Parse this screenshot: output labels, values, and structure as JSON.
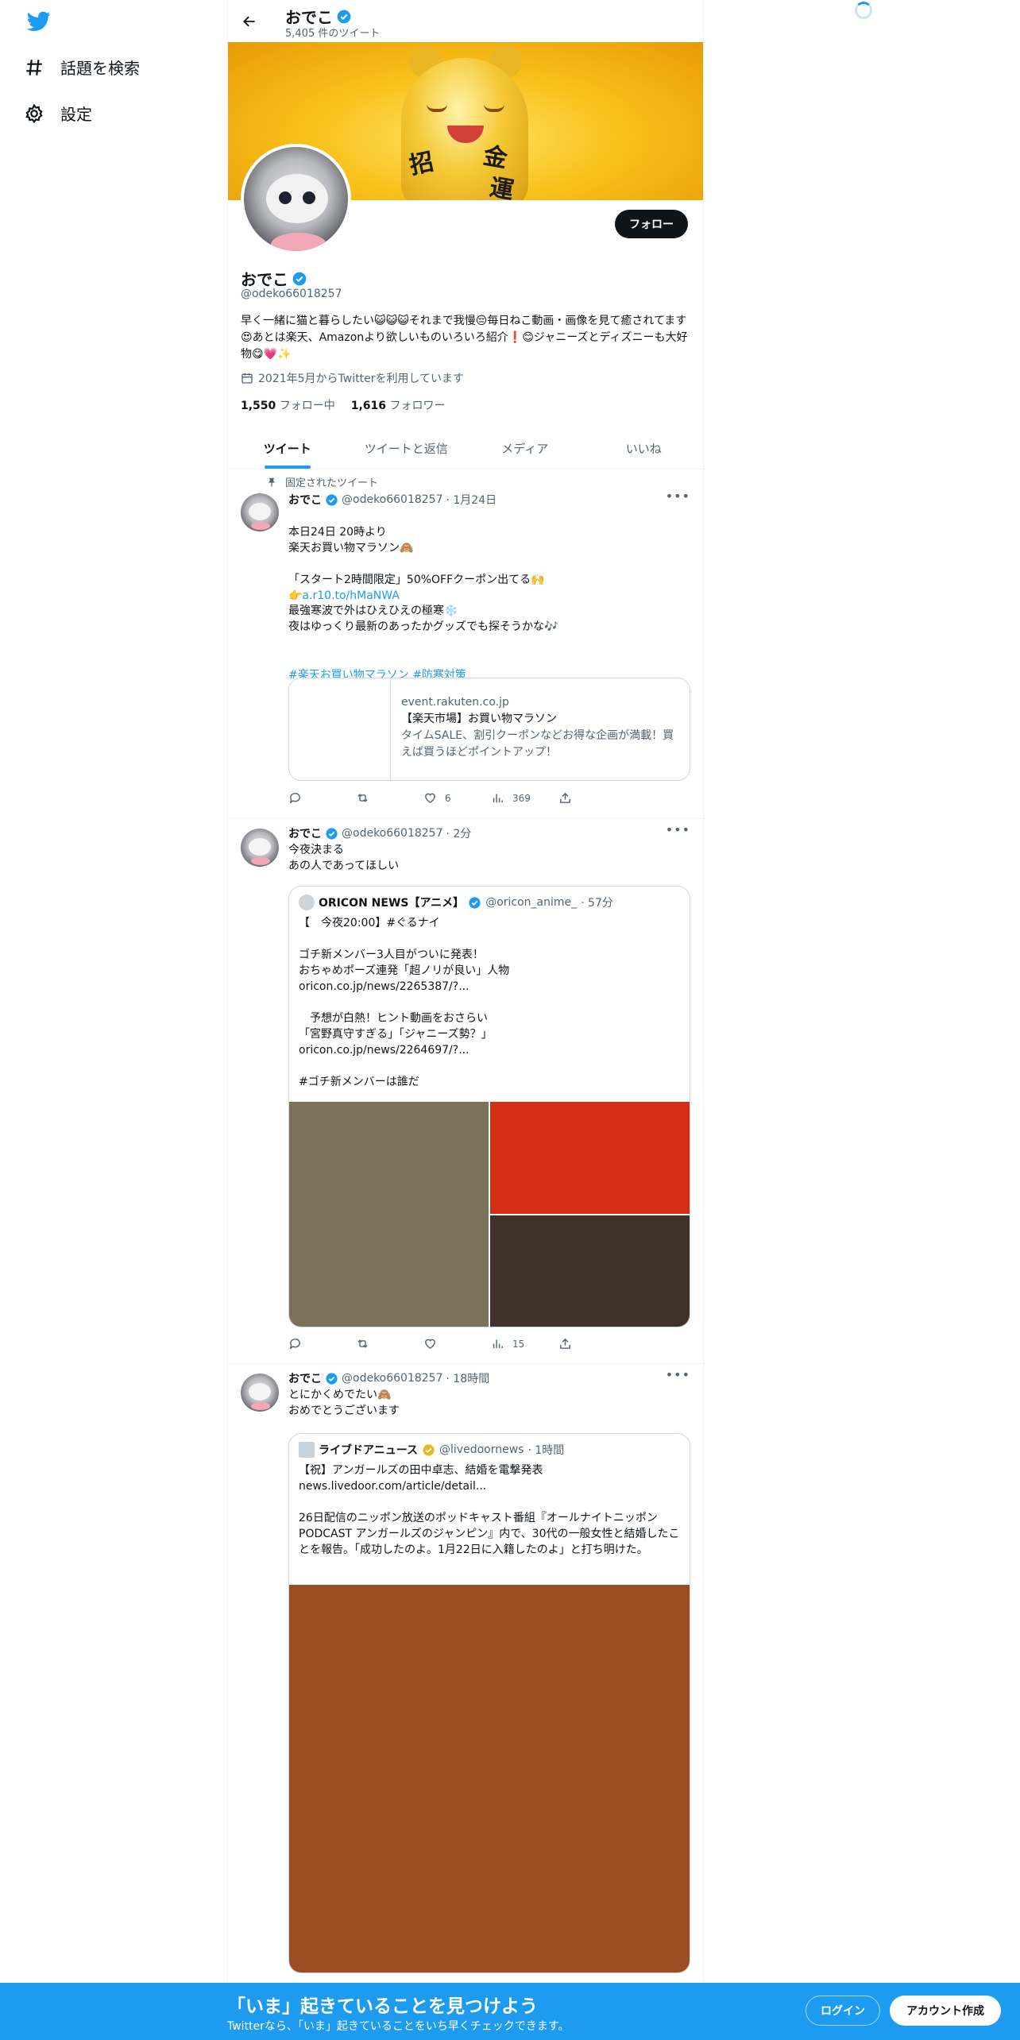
{
  "nav": {
    "explore_label": "話題を検索",
    "settings_label": "設定"
  },
  "header": {
    "name": "おでこ",
    "tweet_count": "5,405 件のツイート"
  },
  "banner": {
    "chars": [
      "招",
      "金",
      "運"
    ]
  },
  "profile": {
    "follow_label": "フォロー",
    "name": "おでこ",
    "handle": "@odeko66018257",
    "bio": "早く一緒に猫と暮らしたい😺😺😺それまで我慢😔毎日ねこ動画・画像を見て癒されてます😍あとは楽天、Amazonより欲しいものいろいろ紹介❗😊ジャニーズとディズニーも大好物😋💗✨",
    "joined": "2021年5月からTwitterを利用しています",
    "following_count": "1,550",
    "following_label": "フォロー中",
    "followers_count": "1,616",
    "followers_label": "フォロワー"
  },
  "tabs": [
    "ツイート",
    "ツイートと返信",
    "メディア",
    "いいね"
  ],
  "tweets": [
    {
      "pinned_label": "固定されたツイート",
      "name": "おでこ",
      "handle": "@odeko66018257",
      "time": "· 1月24日",
      "text_a": "本日24日 20時より\n楽天お買い物マラソン🙈\n\n「スタート2時間限定」50%OFFクーポン出てる🙌\n👉",
      "link": "a.r10.to/hMaNWA",
      "text_b": "最強寒波で外はひえひえの極寒❄️\n夜はゆっくり最新のあったかグッズでも探そうかな🎶",
      "hashtag1": "#楽天お買い物マラソン",
      "hashtag2": "#防寒対策",
      "card": {
        "domain": "event.rakuten.co.jp",
        "title": "【楽天市場】お買い物マラソン",
        "desc": "タイムSALE、割引クーポンなどお得な企画が満載！買えば買うほどポイントアップ！"
      },
      "likes": "6",
      "views": "369"
    },
    {
      "name": "おでこ",
      "handle": "@odeko66018257",
      "time": "· 2分",
      "text": "今夜決まる\nあの人であってほしい",
      "quote": {
        "name": "ORICON NEWS【アニメ】",
        "handle": "@oricon_anime_",
        "time": "· 57分",
        "text": "【　今夜20:00】#ぐるナイ\n\nゴチ新メンバー3人目がついに発表！\nおちゃめポーズ連発「超ノリが良い」人物\noricon.co.jp/news/2265387/?...\n\n　予想が白熱！ヒント動画をおさらい\n「宮野真守すぎる」「ジャニーズ勢？」\noricon.co.jp/news/2264697/?...\n\n#ゴチ新メンバーは誰だ"
      },
      "views": "15"
    },
    {
      "name": "おでこ",
      "handle": "@odeko66018257",
      "time": "· 18時間",
      "text": "とにかくめでたい🙈\nおめでとうございます",
      "quote": {
        "name": "ライブドアニュース",
        "handle": "@livedoornews",
        "time": "· 1時間",
        "text": "【祝】アンガールズの田中卓志、結婚を電撃発表\nnews.livedoor.com/article/detail...\n\n26日配信のニッポン放送のポッドキャスト番組『オールナイトニッポンPODCAST アンガールズのジャンピン』内で、30代の一般女性と結婚したことを報告。「成功したのよ。1月22日に入籍したのよ」と打ち明けた。"
      }
    }
  ],
  "bottom": {
    "title": "「いま」起きていることを見つけよう",
    "subtitle": "Twitterなら、「いま」起きていることをいち早くチェックできます。",
    "login_label": "ログイン",
    "signup_label": "アカウント作成"
  },
  "colors": {
    "accent": "#1d9bf0",
    "text": "#0f1419",
    "muted": "#536471",
    "media_1": "#7a7259",
    "media_2": "#d42e14",
    "media_3": "#41312b",
    "media_4": "#9c4e22"
  },
  "icons": [
    "twitter-logo",
    "hashtag-icon",
    "gear-icon",
    "back-arrow-icon",
    "verified-icon",
    "calendar-icon",
    "pin-icon",
    "reply-icon",
    "retweet-icon",
    "like-icon",
    "views-icon",
    "share-icon",
    "more-icon"
  ]
}
